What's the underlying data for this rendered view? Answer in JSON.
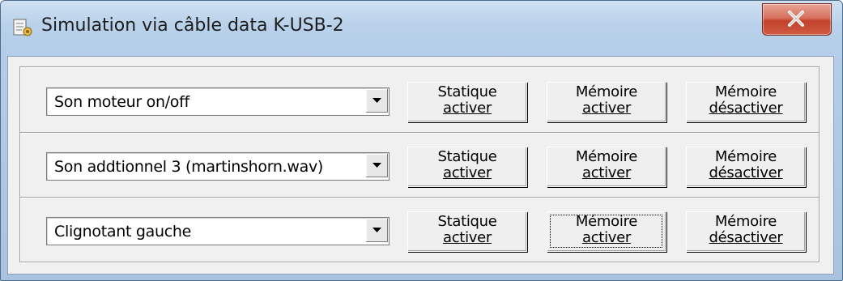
{
  "window": {
    "title": "Simulation via câble data K-USB-2",
    "close_label": "Close"
  },
  "rows": [
    {
      "selected": "Son moteur on/off",
      "buttons": [
        {
          "line1": "Statique",
          "line2": "activer"
        },
        {
          "line1": "Mémoire",
          "line2": "activer"
        },
        {
          "line1": "Mémoire",
          "line2": "désactiver"
        }
      ]
    },
    {
      "selected": "Son addtionnel 3 (martinshorn.wav)",
      "buttons": [
        {
          "line1": "Statique",
          "line2": "activer"
        },
        {
          "line1": "Mémoire",
          "line2": "activer"
        },
        {
          "line1": "Mémoire",
          "line2": "désactiver"
        }
      ]
    },
    {
      "selected": "Clignotant gauche",
      "buttons": [
        {
          "line1": "Statique",
          "line2": "activer"
        },
        {
          "line1": "Mémoire",
          "line2": "activer"
        },
        {
          "line1": "Mémoire",
          "line2": "désactiver"
        }
      ]
    }
  ],
  "focused_button": "row-3 memoire-activer",
  "colors": {
    "title_bar": "#b9d1ea",
    "client_bg": "#f0f0f0",
    "close_button": "#c2412b"
  }
}
